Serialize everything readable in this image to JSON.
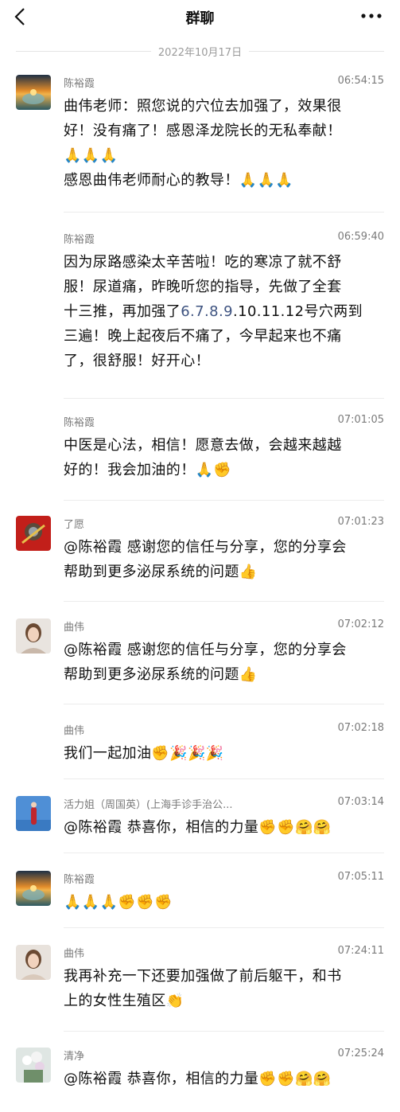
{
  "header": {
    "title": "群聊"
  },
  "date_separator": "2022年10月17日",
  "messages": [
    {
      "sender": "陈裕霞",
      "time": "06:54:15",
      "lines": [
        "曲伟老师：照您说的穴位去加强了，效果很",
        "好！没有痛了！感恩泽龙院长的无私奉献！",
        "🙏🙏🙏",
        "感恩曲伟老师耐心的教导！🙏🙏🙏"
      ]
    },
    {
      "sender": "陈裕霞",
      "time": "06:59:40",
      "lines": [
        "因为尿路感染太辛苦啦！吃的寒凉了就不舒",
        "服！尿道痛，昨晚听您的指导，先做了全套",
        "十三推，再加强了",
        "三遍！晚上起夜后不痛了，今早起来也不痛",
        "了，很舒服！好开心！"
      ],
      "highlight": "6.7.8.9",
      "after_highlight": ".10.11.12号穴两到"
    },
    {
      "sender": "陈裕霞",
      "time": "07:01:05",
      "lines": [
        "中医是心法，相信！愿意去做，会越来越越",
        "好的！我会加油的！🙏✊"
      ]
    },
    {
      "sender": "了愿",
      "time": "07:01:23",
      "lines": [
        "@陈裕霞 感谢您的信任与分享，您的分享会",
        "帮助到更多泌尿系统的问题👍"
      ]
    },
    {
      "sender": "曲伟",
      "time": "07:02:12",
      "lines": [
        "@陈裕霞 感谢您的信任与分享，您的分享会",
        "帮助到更多泌尿系统的问题👍"
      ]
    },
    {
      "sender": "曲伟",
      "time": "07:02:18",
      "lines": [
        "我们一起加油✊🎉🎉🎉"
      ]
    },
    {
      "sender": "活力姐（周国英）(上海手诊手治公...",
      "time": "07:03:14",
      "lines": [
        "@陈裕霞 恭喜你，相信的力量✊✊🤗🤗"
      ]
    },
    {
      "sender": "陈裕霞",
      "time": "07:05:11",
      "lines": [
        "🙏🙏🙏✊✊✊"
      ]
    },
    {
      "sender": "曲伟",
      "time": "07:24:11",
      "lines": [
        "我再补充一下还要加强做了前后躯干，和书",
        "上的女性生殖区👏"
      ]
    },
    {
      "sender": "清净",
      "time": "07:25:24",
      "lines": [
        "@陈裕霞 恭喜你，相信的力量✊✊🤗🤗"
      ]
    }
  ],
  "icons": {
    "back": "chevron-left-icon",
    "more": "more-dots-icon"
  }
}
